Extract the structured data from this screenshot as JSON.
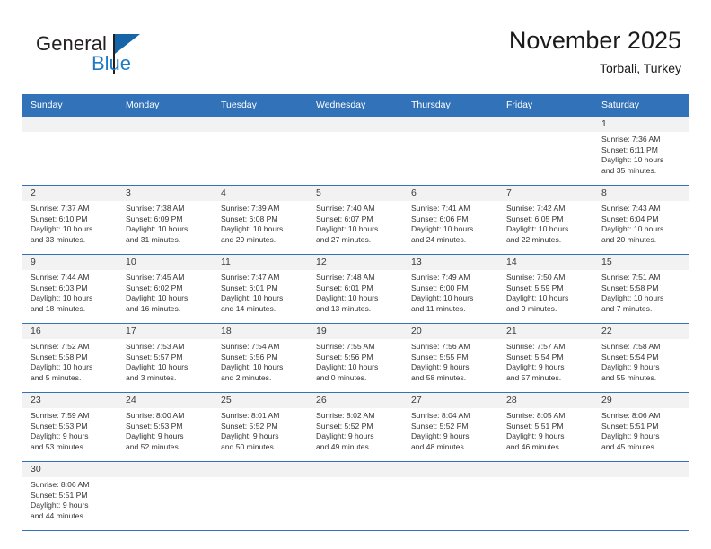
{
  "brand": {
    "line1": "General",
    "line2": "Blue",
    "accent_color": "#1565a8",
    "text_color": "#231f20"
  },
  "header": {
    "title": "November 2025",
    "subtitle": "Torbali, Turkey"
  },
  "calendar": {
    "header_bg": "#3272b8",
    "daynum_bg": "#f2f2f2",
    "weekday_headers": [
      "Sunday",
      "Monday",
      "Tuesday",
      "Wednesday",
      "Thursday",
      "Friday",
      "Saturday"
    ],
    "weeks": [
      [
        {
          "day": "",
          "sunrise": "",
          "sunset": "",
          "daylight1": "",
          "daylight2": ""
        },
        {
          "day": "",
          "sunrise": "",
          "sunset": "",
          "daylight1": "",
          "daylight2": ""
        },
        {
          "day": "",
          "sunrise": "",
          "sunset": "",
          "daylight1": "",
          "daylight2": ""
        },
        {
          "day": "",
          "sunrise": "",
          "sunset": "",
          "daylight1": "",
          "daylight2": ""
        },
        {
          "day": "",
          "sunrise": "",
          "sunset": "",
          "daylight1": "",
          "daylight2": ""
        },
        {
          "day": "",
          "sunrise": "",
          "sunset": "",
          "daylight1": "",
          "daylight2": ""
        },
        {
          "day": "1",
          "sunrise": "Sunrise: 7:36 AM",
          "sunset": "Sunset: 6:11 PM",
          "daylight1": "Daylight: 10 hours",
          "daylight2": "and 35 minutes."
        }
      ],
      [
        {
          "day": "2",
          "sunrise": "Sunrise: 7:37 AM",
          "sunset": "Sunset: 6:10 PM",
          "daylight1": "Daylight: 10 hours",
          "daylight2": "and 33 minutes."
        },
        {
          "day": "3",
          "sunrise": "Sunrise: 7:38 AM",
          "sunset": "Sunset: 6:09 PM",
          "daylight1": "Daylight: 10 hours",
          "daylight2": "and 31 minutes."
        },
        {
          "day": "4",
          "sunrise": "Sunrise: 7:39 AM",
          "sunset": "Sunset: 6:08 PM",
          "daylight1": "Daylight: 10 hours",
          "daylight2": "and 29 minutes."
        },
        {
          "day": "5",
          "sunrise": "Sunrise: 7:40 AM",
          "sunset": "Sunset: 6:07 PM",
          "daylight1": "Daylight: 10 hours",
          "daylight2": "and 27 minutes."
        },
        {
          "day": "6",
          "sunrise": "Sunrise: 7:41 AM",
          "sunset": "Sunset: 6:06 PM",
          "daylight1": "Daylight: 10 hours",
          "daylight2": "and 24 minutes."
        },
        {
          "day": "7",
          "sunrise": "Sunrise: 7:42 AM",
          "sunset": "Sunset: 6:05 PM",
          "daylight1": "Daylight: 10 hours",
          "daylight2": "and 22 minutes."
        },
        {
          "day": "8",
          "sunrise": "Sunrise: 7:43 AM",
          "sunset": "Sunset: 6:04 PM",
          "daylight1": "Daylight: 10 hours",
          "daylight2": "and 20 minutes."
        }
      ],
      [
        {
          "day": "9",
          "sunrise": "Sunrise: 7:44 AM",
          "sunset": "Sunset: 6:03 PM",
          "daylight1": "Daylight: 10 hours",
          "daylight2": "and 18 minutes."
        },
        {
          "day": "10",
          "sunrise": "Sunrise: 7:45 AM",
          "sunset": "Sunset: 6:02 PM",
          "daylight1": "Daylight: 10 hours",
          "daylight2": "and 16 minutes."
        },
        {
          "day": "11",
          "sunrise": "Sunrise: 7:47 AM",
          "sunset": "Sunset: 6:01 PM",
          "daylight1": "Daylight: 10 hours",
          "daylight2": "and 14 minutes."
        },
        {
          "day": "12",
          "sunrise": "Sunrise: 7:48 AM",
          "sunset": "Sunset: 6:01 PM",
          "daylight1": "Daylight: 10 hours",
          "daylight2": "and 13 minutes."
        },
        {
          "day": "13",
          "sunrise": "Sunrise: 7:49 AM",
          "sunset": "Sunset: 6:00 PM",
          "daylight1": "Daylight: 10 hours",
          "daylight2": "and 11 minutes."
        },
        {
          "day": "14",
          "sunrise": "Sunrise: 7:50 AM",
          "sunset": "Sunset: 5:59 PM",
          "daylight1": "Daylight: 10 hours",
          "daylight2": "and 9 minutes."
        },
        {
          "day": "15",
          "sunrise": "Sunrise: 7:51 AM",
          "sunset": "Sunset: 5:58 PM",
          "daylight1": "Daylight: 10 hours",
          "daylight2": "and 7 minutes."
        }
      ],
      [
        {
          "day": "16",
          "sunrise": "Sunrise: 7:52 AM",
          "sunset": "Sunset: 5:58 PM",
          "daylight1": "Daylight: 10 hours",
          "daylight2": "and 5 minutes."
        },
        {
          "day": "17",
          "sunrise": "Sunrise: 7:53 AM",
          "sunset": "Sunset: 5:57 PM",
          "daylight1": "Daylight: 10 hours",
          "daylight2": "and 3 minutes."
        },
        {
          "day": "18",
          "sunrise": "Sunrise: 7:54 AM",
          "sunset": "Sunset: 5:56 PM",
          "daylight1": "Daylight: 10 hours",
          "daylight2": "and 2 minutes."
        },
        {
          "day": "19",
          "sunrise": "Sunrise: 7:55 AM",
          "sunset": "Sunset: 5:56 PM",
          "daylight1": "Daylight: 10 hours",
          "daylight2": "and 0 minutes."
        },
        {
          "day": "20",
          "sunrise": "Sunrise: 7:56 AM",
          "sunset": "Sunset: 5:55 PM",
          "daylight1": "Daylight: 9 hours",
          "daylight2": "and 58 minutes."
        },
        {
          "day": "21",
          "sunrise": "Sunrise: 7:57 AM",
          "sunset": "Sunset: 5:54 PM",
          "daylight1": "Daylight: 9 hours",
          "daylight2": "and 57 minutes."
        },
        {
          "day": "22",
          "sunrise": "Sunrise: 7:58 AM",
          "sunset": "Sunset: 5:54 PM",
          "daylight1": "Daylight: 9 hours",
          "daylight2": "and 55 minutes."
        }
      ],
      [
        {
          "day": "23",
          "sunrise": "Sunrise: 7:59 AM",
          "sunset": "Sunset: 5:53 PM",
          "daylight1": "Daylight: 9 hours",
          "daylight2": "and 53 minutes."
        },
        {
          "day": "24",
          "sunrise": "Sunrise: 8:00 AM",
          "sunset": "Sunset: 5:53 PM",
          "daylight1": "Daylight: 9 hours",
          "daylight2": "and 52 minutes."
        },
        {
          "day": "25",
          "sunrise": "Sunrise: 8:01 AM",
          "sunset": "Sunset: 5:52 PM",
          "daylight1": "Daylight: 9 hours",
          "daylight2": "and 50 minutes."
        },
        {
          "day": "26",
          "sunrise": "Sunrise: 8:02 AM",
          "sunset": "Sunset: 5:52 PM",
          "daylight1": "Daylight: 9 hours",
          "daylight2": "and 49 minutes."
        },
        {
          "day": "27",
          "sunrise": "Sunrise: 8:04 AM",
          "sunset": "Sunset: 5:52 PM",
          "daylight1": "Daylight: 9 hours",
          "daylight2": "and 48 minutes."
        },
        {
          "day": "28",
          "sunrise": "Sunrise: 8:05 AM",
          "sunset": "Sunset: 5:51 PM",
          "daylight1": "Daylight: 9 hours",
          "daylight2": "and 46 minutes."
        },
        {
          "day": "29",
          "sunrise": "Sunrise: 8:06 AM",
          "sunset": "Sunset: 5:51 PM",
          "daylight1": "Daylight: 9 hours",
          "daylight2": "and 45 minutes."
        }
      ],
      [
        {
          "day": "30",
          "sunrise": "Sunrise: 8:06 AM",
          "sunset": "Sunset: 5:51 PM",
          "daylight1": "Daylight: 9 hours",
          "daylight2": "and 44 minutes."
        },
        {
          "day": "",
          "sunrise": "",
          "sunset": "",
          "daylight1": "",
          "daylight2": ""
        },
        {
          "day": "",
          "sunrise": "",
          "sunset": "",
          "daylight1": "",
          "daylight2": ""
        },
        {
          "day": "",
          "sunrise": "",
          "sunset": "",
          "daylight1": "",
          "daylight2": ""
        },
        {
          "day": "",
          "sunrise": "",
          "sunset": "",
          "daylight1": "",
          "daylight2": ""
        },
        {
          "day": "",
          "sunrise": "",
          "sunset": "",
          "daylight1": "",
          "daylight2": ""
        },
        {
          "day": "",
          "sunrise": "",
          "sunset": "",
          "daylight1": "",
          "daylight2": ""
        }
      ]
    ]
  }
}
